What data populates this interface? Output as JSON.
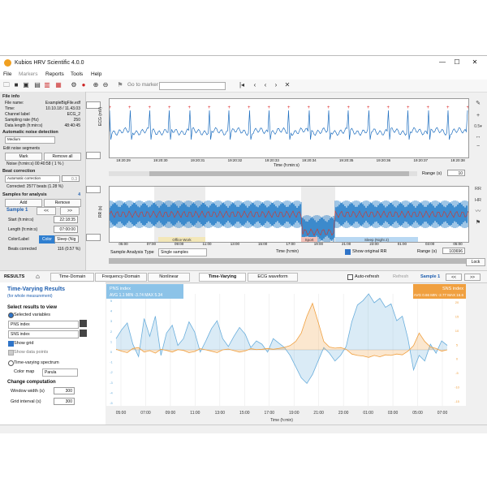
{
  "window": {
    "title": "Kubios HRV Scientific 4.0.0"
  },
  "menu": [
    "File",
    "Markers",
    "Reports",
    "Tools",
    "Help"
  ],
  "toolbar": {
    "goto_placeholder": "Go to marker"
  },
  "file_info": {
    "heading": "File info",
    "rows": [
      {
        "label": "File name:",
        "value": "ExampleBigFile.edf"
      },
      {
        "label": "Time:",
        "value": "10.10.18 / 11.43.03"
      },
      {
        "label": "Channel label",
        "value": "ECG_2"
      },
      {
        "label": "Sampling rate (Hz)",
        "value": "250"
      },
      {
        "label": "Data length (h:min:s)",
        "value": "48:40:45"
      }
    ]
  },
  "noise": {
    "heading": "Automatic noise detection",
    "level": "Medium",
    "edit_label": "Edit noise segments",
    "mark_label": "Mark",
    "remove_all_label": "Remove all",
    "noise_line": "Noise (h:min:s)  00:40:58 ( 1 % )"
  },
  "beat": {
    "heading": "Beat correction",
    "method": "Automatic correction",
    "threshold": "0.3",
    "corrected": "Corrected: 2577 beats (1.28 %)"
  },
  "samples": {
    "heading": "Samples for analysis",
    "count": "4",
    "add_label": "Add",
    "remove_label": "Remove",
    "current": "Sample 1",
    "prev": "<<",
    "next": ">>",
    "start_label": "Start (h:min:s)",
    "start_value": "22:18:35",
    "length_label": "Length (h:min:s)",
    "length_value": "07:00:00",
    "colorlabel_label": "Color/Label",
    "color_name": "Color",
    "label_value": "Sleep (Nig",
    "beats_corrected_label": "Beats corrected",
    "beats_corrected_value": "116 (0.57 %)"
  },
  "ecg": {
    "ylabel": "ECG (mV)",
    "xlabel": "Time (h:min:s)",
    "ticks": [
      "19:20:29",
      "19:20:30",
      "19:20:31",
      "19:20:32",
      "19:20:33",
      "19:20:34",
      "19:20:35",
      "19:20:36",
      "19:20:37",
      "19:20:38"
    ],
    "range_label": "Range (s)",
    "range_value": "10"
  },
  "rr": {
    "ylabel": "RR (s)",
    "xlabel": "Time (h:min)",
    "ticks": [
      "05:00",
      "07:00",
      "09:00",
      "11:00",
      "13:00",
      "15:00",
      "17:00",
      "19:00",
      "21:00",
      "23:00",
      "01:00",
      "03:00",
      "05:00"
    ],
    "segments": [
      "Office Work",
      "Sport",
      "Sleep (Night 2)"
    ],
    "side_rr": "RR",
    "side_hr": "HR",
    "sample_type_label": "Sample Analysis Type",
    "sample_type_value": "Single samples",
    "show_original": "Show original RR",
    "range_label": "Range (s)",
    "range_value": "103696",
    "lock_label": "Lock"
  },
  "results_bar": {
    "label": "RESULTS",
    "tabs": [
      "Time-Domain",
      "Frequency-Domain",
      "Nonlinear",
      "Time-Varying",
      "ECG waveform"
    ],
    "active_tab": "Time-Varying",
    "auto_refresh": "Auto-refresh",
    "refresh": "Refresh",
    "sample": "Sample 1",
    "prev": "<<",
    "next": ">>"
  },
  "tv": {
    "title": "Time-Varying Results",
    "subtitle": "(for whole measurement)",
    "select_heading": "Select results to view",
    "selected_variables": "Selected variables",
    "var1": "PNS index",
    "var2": "SNS index",
    "show_grid": "Show grid",
    "show_points": "Show data points",
    "tv_spectrum": "Time-varying spectrum",
    "colormap_label": "Color map",
    "colormap_value": "Parula",
    "change_heading": "Change computation",
    "window_label": "Window width (s)",
    "window_value": "300",
    "grid_label": "Grid interval (s)",
    "grid_value": "300"
  },
  "chart_data": {
    "type": "line",
    "xlabel": "Time (h:min)",
    "x_ticks": [
      "05:00",
      "07:00",
      "09:00",
      "11:00",
      "13:00",
      "15:00",
      "17:00",
      "19:00",
      "21:00",
      "23:00",
      "01:00",
      "03:00",
      "05:00",
      "07:00"
    ],
    "series": [
      {
        "name": "PNS index",
        "color": "#6aaedc",
        "axis": "left",
        "stats": [
          "AVG 1.1",
          "MIN -3.74",
          "MAX 5.34"
        ],
        "values": [
          1.0,
          1.8,
          2.4,
          0.5,
          -0.6,
          2.8,
          1.2,
          3.0,
          -0.5,
          1.5,
          2.2,
          0.4,
          1.0,
          2.5,
          1.6,
          -0.2,
          0.8,
          1.9,
          2.6,
          1.0,
          0.3,
          1.2,
          2.0,
          1.4,
          0.2,
          0.8,
          0.5,
          -0.2,
          1.0,
          0.6,
          0.2,
          -0.5,
          -1.5,
          -2.5,
          -3.0,
          -2.2,
          -1.0,
          0.2,
          -0.3,
          -1.0,
          -0.5,
          0.3,
          2.5,
          4.0,
          4.4,
          5.0,
          4.2,
          4.6,
          3.8,
          4.1,
          2.6,
          3.0,
          1.0,
          -1.8,
          -0.5,
          -1.0,
          0.5,
          -0.3,
          0.8,
          0.4
        ]
      },
      {
        "name": "SNS index",
        "color": "#f0a040",
        "axis": "right",
        "stats": [
          "AVG 0.66",
          "MIN -2.77",
          "MAX 16.6"
        ],
        "values": [
          0.2,
          -0.5,
          -1.0,
          0.5,
          0.8,
          -0.8,
          -0.3,
          -1.2,
          0.2,
          -0.2,
          -0.8,
          0.1,
          -0.2,
          -1.0,
          -0.6,
          0.4,
          0.0,
          -0.5,
          -1.0,
          0.0,
          0.3,
          -0.3,
          -0.8,
          -0.4,
          0.4,
          0.1,
          0.2,
          0.5,
          0.2,
          0.5,
          0.9,
          1.5,
          3.0,
          6.0,
          12.0,
          16.6,
          10.0,
          3.0,
          1.0,
          0.6,
          0.8,
          0.2,
          -1.5,
          -2.0,
          -2.2,
          -2.7,
          -2.0,
          -2.5,
          -1.8,
          -2.0,
          -1.5,
          -1.8,
          -0.5,
          1.5,
          6.0,
          3.0,
          1.0,
          0.5,
          -0.5,
          0.0
        ]
      }
    ],
    "ylim_left": [
      -5,
      5
    ],
    "ylim_right": [
      -20,
      20
    ],
    "left_ticks": [
      "5",
      "4",
      "3",
      "2",
      "1",
      "0",
      "-1",
      "-2",
      "-3",
      "-4",
      "-5"
    ],
    "right_ticks": [
      "20",
      "15",
      "10",
      "5",
      "0",
      "-5",
      "-10",
      "-15"
    ],
    "grid": true
  }
}
